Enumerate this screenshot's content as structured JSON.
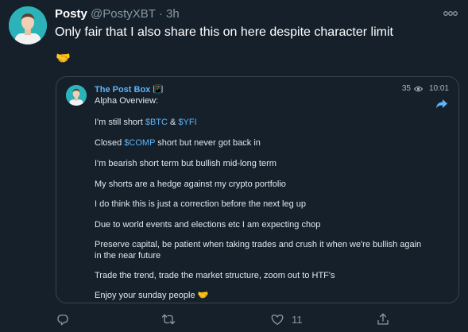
{
  "tweet": {
    "author_name": "Posty",
    "handle": "@PostyXBT",
    "separator": "·",
    "time": "3h",
    "text": "Only fair that I also share this on here despite character limit",
    "emoji": "🤝"
  },
  "card": {
    "channel_name": "The Post Box",
    "channel_badge": "📳",
    "subtitle": "Alpha Overview:",
    "views": "35",
    "time": "10:01",
    "lines": {
      "l1_prefix": "I'm still short ",
      "l1_cash1": "$BTC",
      "l1_mid": " & ",
      "l1_cash2": "$YFI",
      "l2_prefix": "Closed ",
      "l2_cash": "$COMP",
      "l2_suffix": " short but never got back in",
      "l3": "I'm bearish short term but bullish mid-long term",
      "l4": "My shorts are a hedge against my crypto portfolio",
      "l5": "I do think this is just a correction before the next leg up",
      "l6": "Due to world events and elections etc I am expecting chop",
      "l7a": "Preserve capital, be patient when taking trades and crush it when we're bullish again",
      "l7b": "in the near future",
      "l8": "Trade the trend, trade the market structure, zoom out to HTF's",
      "l9": "Enjoy your sunday people 🤝"
    }
  },
  "actions": {
    "reply_count": "",
    "retweet_count": "",
    "like_count": "11",
    "share_count": ""
  },
  "icons": {
    "more": "more-horizontal-icon",
    "eye": "eye-icon",
    "forward": "share-arrow-icon",
    "reply": "reply-icon",
    "retweet": "retweet-icon",
    "like": "heart-icon",
    "share": "share-icon"
  },
  "colors": {
    "background": "#15202b",
    "link": "#5eb5f7",
    "muted": "#8899a6",
    "border": "#38444d"
  }
}
